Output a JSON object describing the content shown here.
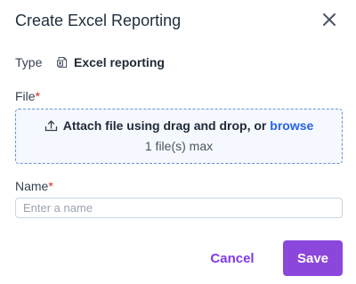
{
  "dialog": {
    "title": "Create Excel Reporting",
    "close_icon": "close-icon"
  },
  "type_row": {
    "label": "Type",
    "icon": "excel-file-icon",
    "value": "Excel reporting"
  },
  "file_field": {
    "label": "File",
    "required_marker": "*",
    "upload_icon": "upload-icon",
    "instruction": "Attach file using drag and drop, or",
    "browse_label": "browse",
    "limit": "1 file(s) max"
  },
  "name_field": {
    "label": "Name",
    "required_marker": "*",
    "value": "",
    "placeholder": "Enter a name"
  },
  "actions": {
    "cancel_label": "Cancel",
    "save_label": "Save"
  },
  "colors": {
    "accent": "#8b46db",
    "link": "#2563eb",
    "required": "#dc2626",
    "dropzone_border": "#6b8fd6"
  }
}
